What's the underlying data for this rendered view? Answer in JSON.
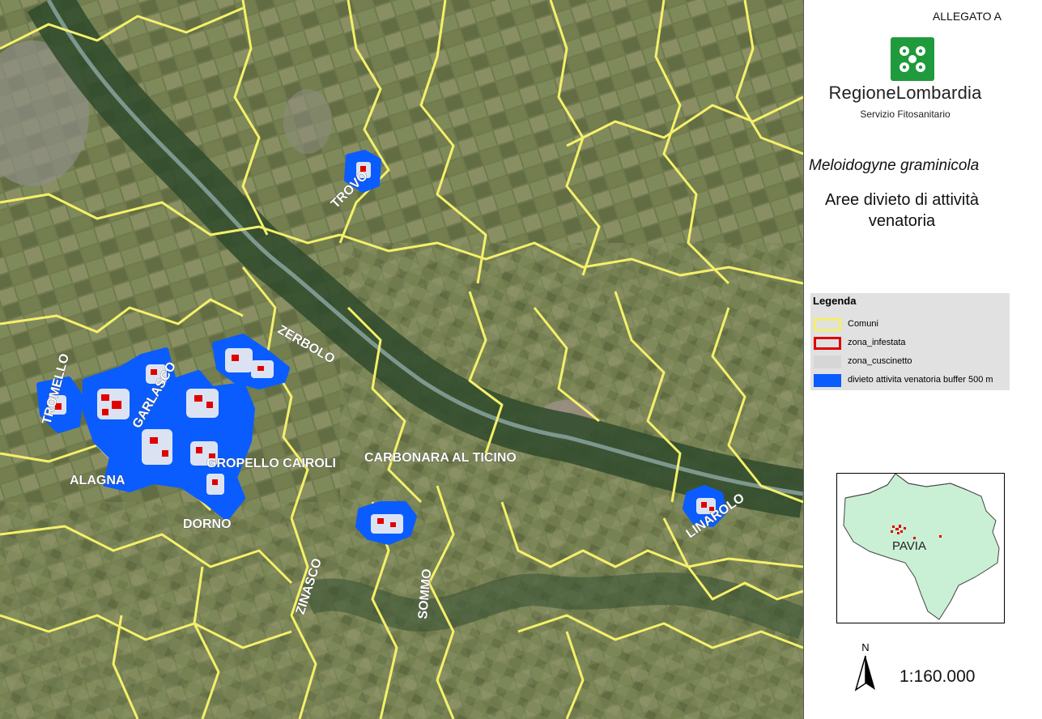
{
  "header": {
    "annex": "ALLEGATO A"
  },
  "logo": {
    "name": "RegioneLombardia",
    "subtitle": "Servizio Fitosanitario",
    "color": "#1f9a3c"
  },
  "title": {
    "species": "Meloidogyne graminicola",
    "subtitle": "Aree divieto di attività venatoria"
  },
  "legend": {
    "title": "Legenda",
    "items": [
      {
        "label": "Comuni",
        "swatch": "yellow-outline",
        "color": "#f5f06a"
      },
      {
        "label": "zona_infestata",
        "swatch": "red-outline",
        "color": "#e00000"
      },
      {
        "label": "zona_cuscinetto",
        "swatch": "gray-fill",
        "color": "#dcdcdc"
      },
      {
        "label": "divieto attivita venatoria buffer 500 m",
        "swatch": "blue-fill",
        "color": "#0a5cff"
      }
    ]
  },
  "map": {
    "municipality_labels": {
      "tromello": "TROMELLO",
      "garlasco": "GARLASCO",
      "zerbolo": "ZERBOLO",
      "trovo": "TROVO",
      "gropello": "GROPELLO CAIROLI",
      "carbonara": "CARBONARA AL TICINO",
      "alagna": "ALAGNA",
      "dorno": "DORNO",
      "zinasco": "ZINASCO",
      "sommo": "SOMMO",
      "linarolo": "LINAROLO"
    }
  },
  "inset": {
    "province_label": "PAVIA",
    "fill": "#c9f0d4"
  },
  "north_arrow": {
    "label": "N"
  },
  "scale": {
    "text": "1:160.000"
  }
}
